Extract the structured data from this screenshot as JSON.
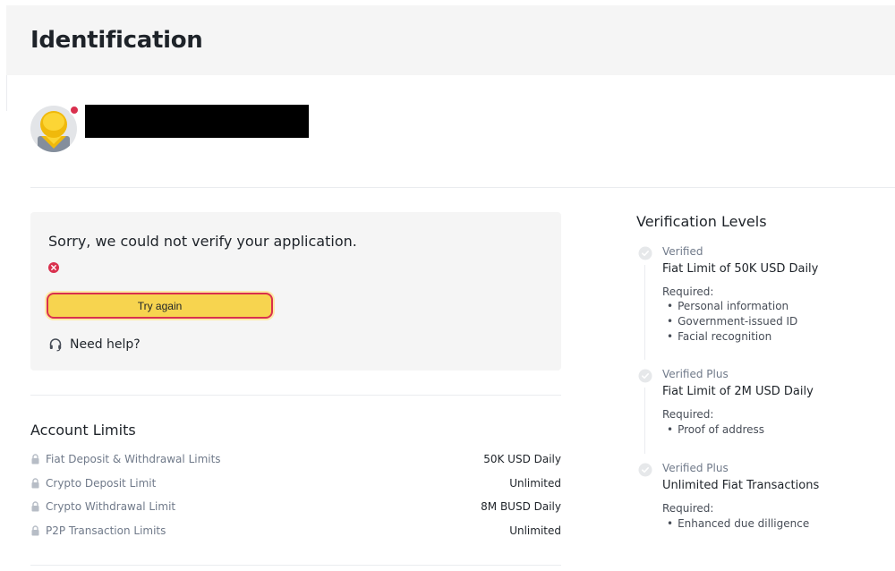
{
  "page": {
    "title": "Identification"
  },
  "profile": {
    "name": "█████████████████████",
    "status_dot_color": "#d9304e"
  },
  "verification_status": {
    "message": "Sorry, we could not verify your application.",
    "error_icon": "error-x-icon",
    "retry_label": "Try again",
    "help_icon": "headset-icon",
    "help_label": "Need help?"
  },
  "account_limits": {
    "title": "Account Limits",
    "rows": [
      {
        "label": "Fiat Deposit & Withdrawal Limits",
        "value": "50K USD Daily",
        "icon": "lock-icon"
      },
      {
        "label": "Crypto Deposit Limit",
        "value": "Unlimited",
        "icon": "lock-icon"
      },
      {
        "label": "Crypto Withdrawal Limit",
        "value": "8M BUSD Daily",
        "icon": "lock-icon"
      },
      {
        "label": "P2P Transaction Limits",
        "value": "Unlimited",
        "icon": "lock-icon"
      }
    ]
  },
  "verification_levels": {
    "title": "Verification Levels",
    "levels": [
      {
        "tier": "Verified",
        "limit": "Fiat Limit of 50K USD Daily",
        "required_label": "Required:",
        "requirements": [
          "Personal information",
          "Government-issued ID",
          "Facial recognition"
        ]
      },
      {
        "tier": "Verified Plus",
        "limit": "Fiat Limit of 2M USD Daily",
        "required_label": "Required:",
        "requirements": [
          "Proof of address"
        ]
      },
      {
        "tier": "Verified Plus",
        "limit": "Unlimited Fiat Transactions",
        "required_label": "Required:",
        "requirements": [
          "Enhanced due dilligence"
        ]
      }
    ]
  },
  "colors": {
    "accent_yellow": "#f7d44f",
    "error_red": "#d9304e",
    "text_primary": "#1e2329",
    "text_secondary": "#707a8a",
    "card_background": "#f5f5f5"
  }
}
